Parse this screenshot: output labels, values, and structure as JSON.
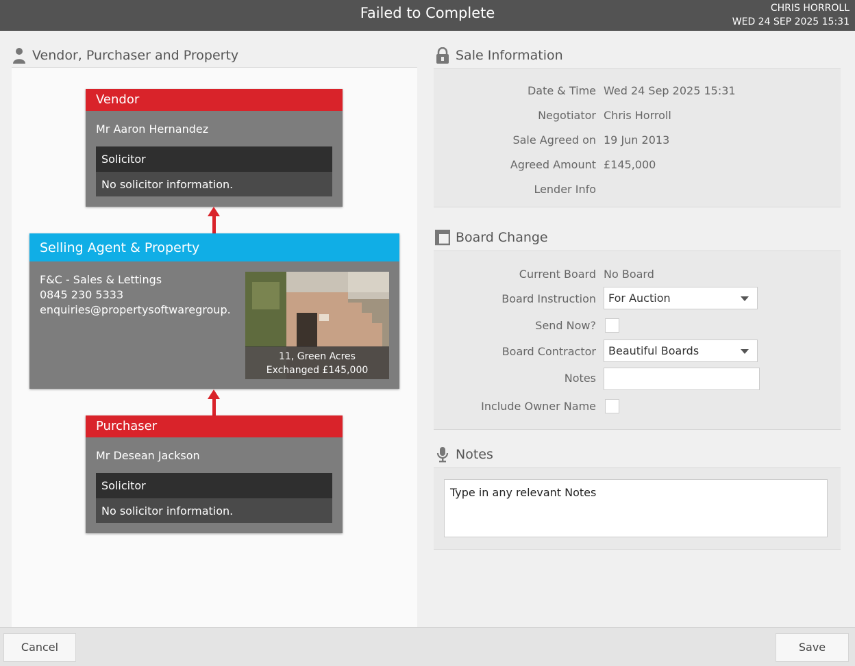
{
  "header": {
    "title": "Failed to Complete",
    "user_name": "CHRIS HORROLL",
    "datetime": "WED 24 SEP 2025 15:31"
  },
  "left": {
    "section_title": "Vendor, Purchaser and Property",
    "vendor": {
      "heading": "Vendor",
      "name": "Mr Aaron Hernandez",
      "solicitor_label": "Solicitor",
      "solicitor_info": "No solicitor information."
    },
    "agent": {
      "heading": "Selling Agent & Property",
      "company": "F&C - Sales & Lettings",
      "phone": "0845 230 5333",
      "email": "enquiries@propertysoftwaregroup....",
      "property_address": "11, Green Acres",
      "property_status": "Exchanged £145,000"
    },
    "purchaser": {
      "heading": "Purchaser",
      "name": "Mr Desean Jackson",
      "solicitor_label": "Solicitor",
      "solicitor_info": "No solicitor information."
    }
  },
  "sale_info": {
    "section_title": "Sale Information",
    "rows": [
      {
        "label": "Date & Time",
        "value": "Wed 24 Sep 2025 15:31"
      },
      {
        "label": "Negotiator",
        "value": "Chris Horroll"
      },
      {
        "label": "Sale Agreed on",
        "value": "19 Jun 2013"
      },
      {
        "label": "Agreed Amount",
        "value": "£145,000"
      },
      {
        "label": "Lender Info",
        "value": ""
      }
    ]
  },
  "board_change": {
    "section_title": "Board Change",
    "current_board_label": "Current Board",
    "current_board_value": "No Board",
    "instruction_label": "Board Instruction",
    "instruction_value": "For Auction",
    "send_now_label": "Send Now?",
    "contractor_label": "Board Contractor",
    "contractor_value": "Beautiful Boards",
    "notes_label": "Notes",
    "include_owner_label": "Include Owner Name"
  },
  "notes": {
    "section_title": "Notes",
    "placeholder": "Type in any relevant Notes"
  },
  "footer": {
    "cancel_label": "Cancel",
    "save_label": "Save"
  },
  "colors": {
    "vendor_red": "#d9232a",
    "agent_blue": "#10aee6",
    "topbar": "#535353"
  }
}
